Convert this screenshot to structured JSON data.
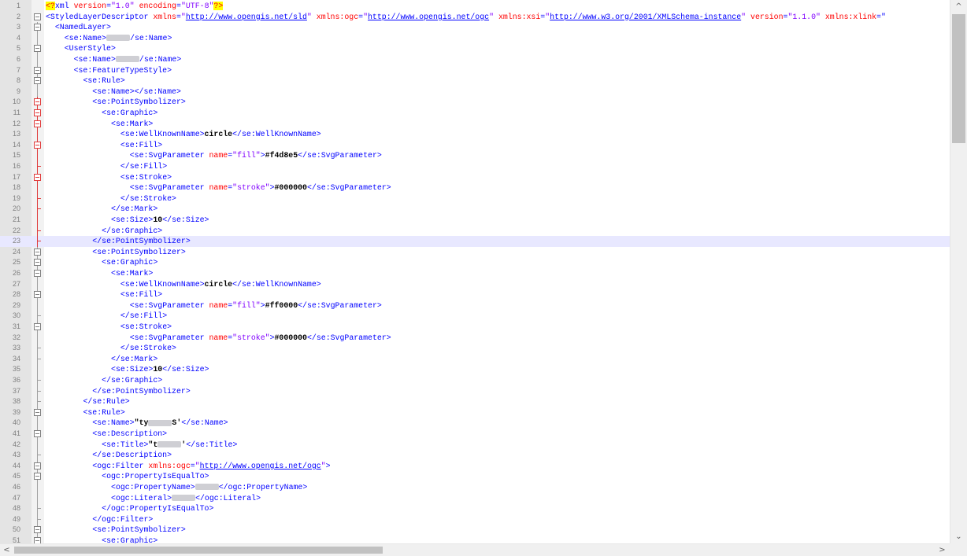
{
  "editor": {
    "current_line": 23,
    "red_fold_lines": [
      10,
      11,
      12,
      13,
      14,
      15,
      16,
      17,
      18,
      19,
      20,
      21,
      22,
      23
    ],
    "lines": [
      {
        "n": "1",
        "fold": "",
        "indent": 0,
        "tokens": [
          [
            "pi",
            "<?"
          ],
          [
            "tag",
            "xml "
          ],
          [
            "attr",
            "version"
          ],
          [
            "tag",
            "="
          ],
          [
            "val",
            "\"1.0\""
          ],
          [
            "tag",
            " "
          ],
          [
            "attr",
            "encoding"
          ],
          [
            "tag",
            "="
          ],
          [
            "val",
            "\"UTF-8\""
          ],
          [
            "pi",
            "?>"
          ]
        ]
      },
      {
        "n": "2",
        "fold": "open",
        "indent": 0,
        "tokens": [
          [
            "tag",
            "<StyledLayerDescriptor "
          ],
          [
            "attr",
            "xmlns"
          ],
          [
            "tag",
            "="
          ],
          [
            "val",
            "\""
          ],
          [
            "link",
            "http://www.opengis.net/sld"
          ],
          [
            "val",
            "\""
          ],
          [
            "tag",
            " "
          ],
          [
            "attr",
            "xmlns:ogc"
          ],
          [
            "tag",
            "="
          ],
          [
            "val",
            "\""
          ],
          [
            "link",
            "http://www.opengis.net/ogc"
          ],
          [
            "val",
            "\""
          ],
          [
            "tag",
            " "
          ],
          [
            "attr",
            "xmlns:xsi"
          ],
          [
            "tag",
            "="
          ],
          [
            "val",
            "\""
          ],
          [
            "link",
            "http://www.w3.org/2001/XMLSchema-instance"
          ],
          [
            "val",
            "\""
          ],
          [
            "tag",
            " "
          ],
          [
            "attr",
            "version"
          ],
          [
            "tag",
            "="
          ],
          [
            "val",
            "\"1.1.0\""
          ],
          [
            "tag",
            " "
          ],
          [
            "attr",
            "xmlns:xlink"
          ],
          [
            "tag",
            "=\""
          ]
        ]
      },
      {
        "n": "3",
        "fold": "open",
        "indent": 1,
        "tokens": [
          [
            "tag",
            "<NamedLayer>"
          ]
        ]
      },
      {
        "n": "4",
        "fold": "line",
        "indent": 2,
        "tokens": [
          [
            "tag",
            "<se:Name>"
          ],
          [
            "blur",
            ""
          ],
          [
            "tag",
            "/se:Name>"
          ]
        ]
      },
      {
        "n": "5",
        "fold": "open",
        "indent": 2,
        "tokens": [
          [
            "tag",
            "<UserStyle>"
          ]
        ]
      },
      {
        "n": "6",
        "fold": "line",
        "indent": 3,
        "tokens": [
          [
            "tag",
            "<se:Name>"
          ],
          [
            "blur",
            ""
          ],
          [
            "tag",
            "/se:Name>"
          ]
        ]
      },
      {
        "n": "7",
        "fold": "open",
        "indent": 3,
        "tokens": [
          [
            "tag",
            "<se:FeatureTypeStyle>"
          ]
        ]
      },
      {
        "n": "8",
        "fold": "open",
        "indent": 4,
        "tokens": [
          [
            "tag",
            "<se:Rule>"
          ]
        ]
      },
      {
        "n": "9",
        "fold": "line",
        "indent": 5,
        "tokens": [
          [
            "tag",
            "<se:Name></se:Name>"
          ]
        ]
      },
      {
        "n": "10",
        "fold": "open",
        "indent": 5,
        "tokens": [
          [
            "tag",
            "<se:PointSymbolizer>"
          ]
        ]
      },
      {
        "n": "11",
        "fold": "open",
        "indent": 6,
        "tokens": [
          [
            "tag",
            "<se:Graphic>"
          ]
        ]
      },
      {
        "n": "12",
        "fold": "open",
        "indent": 7,
        "tokens": [
          [
            "tag",
            "<se:Mark>"
          ]
        ]
      },
      {
        "n": "13",
        "fold": "line",
        "indent": 8,
        "tokens": [
          [
            "tag",
            "<se:WellKnownName>"
          ],
          [
            "text",
            "circle"
          ],
          [
            "tag",
            "</se:WellKnownName>"
          ]
        ]
      },
      {
        "n": "14",
        "fold": "open",
        "indent": 8,
        "tokens": [
          [
            "tag",
            "<se:Fill>"
          ]
        ]
      },
      {
        "n": "15",
        "fold": "line",
        "indent": 9,
        "tokens": [
          [
            "tag",
            "<se:SvgParameter "
          ],
          [
            "attr",
            "name"
          ],
          [
            "tag",
            "="
          ],
          [
            "val",
            "\"fill\""
          ],
          [
            "tag",
            ">"
          ],
          [
            "text",
            "#f4d8e5"
          ],
          [
            "tag",
            "</se:SvgParameter>"
          ]
        ]
      },
      {
        "n": "16",
        "fold": "close",
        "indent": 8,
        "tokens": [
          [
            "tag",
            "</se:Fill>"
          ]
        ]
      },
      {
        "n": "17",
        "fold": "open",
        "indent": 8,
        "tokens": [
          [
            "tag",
            "<se:Stroke>"
          ]
        ]
      },
      {
        "n": "18",
        "fold": "line",
        "indent": 9,
        "tokens": [
          [
            "tag",
            "<se:SvgParameter "
          ],
          [
            "attr",
            "name"
          ],
          [
            "tag",
            "="
          ],
          [
            "val",
            "\"stroke\""
          ],
          [
            "tag",
            ">"
          ],
          [
            "text",
            "#000000"
          ],
          [
            "tag",
            "</se:SvgParameter>"
          ]
        ]
      },
      {
        "n": "19",
        "fold": "close",
        "indent": 8,
        "tokens": [
          [
            "tag",
            "</se:Stroke>"
          ]
        ]
      },
      {
        "n": "20",
        "fold": "close",
        "indent": 7,
        "tokens": [
          [
            "tag",
            "</se:Mark>"
          ]
        ]
      },
      {
        "n": "21",
        "fold": "line",
        "indent": 7,
        "tokens": [
          [
            "tag",
            "<se:Size>"
          ],
          [
            "text",
            "10"
          ],
          [
            "tag",
            "</se:Size>"
          ]
        ]
      },
      {
        "n": "22",
        "fold": "close",
        "indent": 6,
        "tokens": [
          [
            "tag",
            "</se:Graphic>"
          ]
        ]
      },
      {
        "n": "23",
        "fold": "close",
        "indent": 5,
        "tokens": [
          [
            "tag",
            "</se:PointSymbolizer>"
          ]
        ]
      },
      {
        "n": "24",
        "fold": "open",
        "indent": 5,
        "tokens": [
          [
            "tag",
            "<se:PointSymbolizer>"
          ]
        ]
      },
      {
        "n": "25",
        "fold": "open",
        "indent": 6,
        "tokens": [
          [
            "tag",
            "<se:Graphic>"
          ]
        ]
      },
      {
        "n": "26",
        "fold": "open",
        "indent": 7,
        "tokens": [
          [
            "tag",
            "<se:Mark>"
          ]
        ]
      },
      {
        "n": "27",
        "fold": "line",
        "indent": 8,
        "tokens": [
          [
            "tag",
            "<se:WellKnownName>"
          ],
          [
            "text",
            "circle"
          ],
          [
            "tag",
            "</se:WellKnownName>"
          ]
        ]
      },
      {
        "n": "28",
        "fold": "open",
        "indent": 8,
        "tokens": [
          [
            "tag",
            "<se:Fill>"
          ]
        ]
      },
      {
        "n": "29",
        "fold": "line",
        "indent": 9,
        "tokens": [
          [
            "tag",
            "<se:SvgParameter "
          ],
          [
            "attr",
            "name"
          ],
          [
            "tag",
            "="
          ],
          [
            "val",
            "\"fill\""
          ],
          [
            "tag",
            ">"
          ],
          [
            "text",
            "#ff0000"
          ],
          [
            "tag",
            "</se:SvgParameter>"
          ]
        ]
      },
      {
        "n": "30",
        "fold": "close",
        "indent": 8,
        "tokens": [
          [
            "tag",
            "</se:Fill>"
          ]
        ]
      },
      {
        "n": "31",
        "fold": "open",
        "indent": 8,
        "tokens": [
          [
            "tag",
            "<se:Stroke>"
          ]
        ]
      },
      {
        "n": "32",
        "fold": "line",
        "indent": 9,
        "tokens": [
          [
            "tag",
            "<se:SvgParameter "
          ],
          [
            "attr",
            "name"
          ],
          [
            "tag",
            "="
          ],
          [
            "val",
            "\"stroke\""
          ],
          [
            "tag",
            ">"
          ],
          [
            "text",
            "#000000"
          ],
          [
            "tag",
            "</se:SvgParameter>"
          ]
        ]
      },
      {
        "n": "33",
        "fold": "close",
        "indent": 8,
        "tokens": [
          [
            "tag",
            "</se:Stroke>"
          ]
        ]
      },
      {
        "n": "34",
        "fold": "close",
        "indent": 7,
        "tokens": [
          [
            "tag",
            "</se:Mark>"
          ]
        ]
      },
      {
        "n": "35",
        "fold": "line",
        "indent": 7,
        "tokens": [
          [
            "tag",
            "<se:Size>"
          ],
          [
            "text",
            "10"
          ],
          [
            "tag",
            "</se:Size>"
          ]
        ]
      },
      {
        "n": "36",
        "fold": "close",
        "indent": 6,
        "tokens": [
          [
            "tag",
            "</se:Graphic>"
          ]
        ]
      },
      {
        "n": "37",
        "fold": "close",
        "indent": 5,
        "tokens": [
          [
            "tag",
            "</se:PointSymbolizer>"
          ]
        ]
      },
      {
        "n": "38",
        "fold": "close",
        "indent": 4,
        "tokens": [
          [
            "tag",
            "</se:Rule>"
          ]
        ]
      },
      {
        "n": "39",
        "fold": "open",
        "indent": 4,
        "tokens": [
          [
            "tag",
            "<se:Rule>"
          ]
        ]
      },
      {
        "n": "40",
        "fold": "line",
        "indent": 5,
        "tokens": [
          [
            "tag",
            "<se:Name>"
          ],
          [
            "text",
            "\"ty"
          ],
          [
            "blur",
            ""
          ],
          [
            "text",
            "S'"
          ],
          [
            "tag",
            "</se:Name>"
          ]
        ]
      },
      {
        "n": "41",
        "fold": "open",
        "indent": 5,
        "tokens": [
          [
            "tag",
            "<se:Description>"
          ]
        ]
      },
      {
        "n": "42",
        "fold": "line",
        "indent": 6,
        "tokens": [
          [
            "tag",
            "<se:Title>"
          ],
          [
            "text",
            "\"t"
          ],
          [
            "blur",
            ""
          ],
          [
            "text",
            "'"
          ],
          [
            "tag",
            "</se:Title>"
          ]
        ]
      },
      {
        "n": "43",
        "fold": "close",
        "indent": 5,
        "tokens": [
          [
            "tag",
            "</se:Description>"
          ]
        ]
      },
      {
        "n": "44",
        "fold": "open",
        "indent": 5,
        "tokens": [
          [
            "tag",
            "<ogc:Filter "
          ],
          [
            "attr",
            "xmlns:ogc"
          ],
          [
            "tag",
            "="
          ],
          [
            "val",
            "\""
          ],
          [
            "link",
            "http://www.opengis.net/ogc"
          ],
          [
            "val",
            "\""
          ],
          [
            "tag",
            ">"
          ]
        ]
      },
      {
        "n": "45",
        "fold": "open",
        "indent": 6,
        "tokens": [
          [
            "tag",
            "<ogc:PropertyIsEqualTo>"
          ]
        ]
      },
      {
        "n": "46",
        "fold": "line",
        "indent": 7,
        "tokens": [
          [
            "tag",
            "<ogc:PropertyName>"
          ],
          [
            "blur",
            ""
          ],
          [
            "tag",
            "</ogc:PropertyName>"
          ]
        ]
      },
      {
        "n": "47",
        "fold": "line",
        "indent": 7,
        "tokens": [
          [
            "tag",
            "<ogc:Literal>"
          ],
          [
            "blur",
            ""
          ],
          [
            "tag",
            "</ogc:Literal>"
          ]
        ]
      },
      {
        "n": "48",
        "fold": "close",
        "indent": 6,
        "tokens": [
          [
            "tag",
            "</ogc:PropertyIsEqualTo>"
          ]
        ]
      },
      {
        "n": "49",
        "fold": "close",
        "indent": 5,
        "tokens": [
          [
            "tag",
            "</ogc:Filter>"
          ]
        ]
      },
      {
        "n": "50",
        "fold": "open",
        "indent": 5,
        "tokens": [
          [
            "tag",
            "<se:PointSymbolizer>"
          ]
        ]
      },
      {
        "n": "51",
        "fold": "open",
        "indent": 6,
        "tokens": [
          [
            "tag",
            "<se:Graphic>"
          ]
        ]
      }
    ]
  },
  "scrollbars": {
    "up_arrow": "^",
    "down_arrow": "⌄",
    "left_arrow": "<",
    "right_arrow": ">"
  },
  "colors": {
    "tag": "#0000ff",
    "attribute": "#ff0000",
    "value": "#8000ff",
    "current_line": "#e8e8ff",
    "gutter": "#e4e4e4"
  }
}
